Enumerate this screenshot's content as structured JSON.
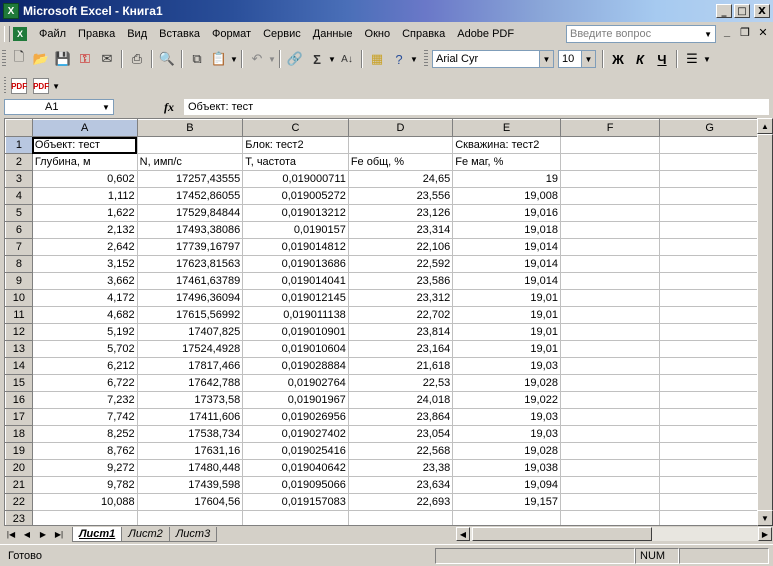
{
  "window": {
    "title": "Microsoft Excel - Книга1",
    "minimize": "_",
    "maximize": "□",
    "close": "X"
  },
  "menu": {
    "items": [
      "Файл",
      "Правка",
      "Вид",
      "Вставка",
      "Формат",
      "Сервис",
      "Данные",
      "Окно",
      "Справка",
      "Adobe PDF"
    ],
    "help_placeholder": "Введите вопрос"
  },
  "format_toolbar": {
    "font_name": "Arial Cyr",
    "font_size": "10",
    "bold": "Ж",
    "italic": "К",
    "underline": "Ч"
  },
  "formula_bar": {
    "cell_ref": "A1",
    "fx": "fx",
    "content": "Объект: тест"
  },
  "sheet": {
    "columns": [
      "A",
      "B",
      "C",
      "D",
      "E",
      "F",
      "G"
    ],
    "rows": [
      [
        "Объект: тест",
        "",
        "Блок: тест2",
        "",
        "Скважина: тест2",
        "",
        ""
      ],
      [
        "Глубина, м",
        "N, имп/с",
        "T, частота",
        "Fe общ, %",
        "Fe маг, %",
        "",
        ""
      ],
      [
        "0,602",
        "17257,43555",
        "0,019000711",
        "24,65",
        "19",
        "",
        ""
      ],
      [
        "1,112",
        "17452,86055",
        "0,019005272",
        "23,556",
        "19,008",
        "",
        ""
      ],
      [
        "1,622",
        "17529,84844",
        "0,019013212",
        "23,126",
        "19,016",
        "",
        ""
      ],
      [
        "2,132",
        "17493,38086",
        "0,0190157",
        "23,314",
        "19,018",
        "",
        ""
      ],
      [
        "2,642",
        "17739,16797",
        "0,019014812",
        "22,106",
        "19,014",
        "",
        ""
      ],
      [
        "3,152",
        "17623,81563",
        "0,019013686",
        "22,592",
        "19,014",
        "",
        ""
      ],
      [
        "3,662",
        "17461,63789",
        "0,019014041",
        "23,586",
        "19,014",
        "",
        ""
      ],
      [
        "4,172",
        "17496,36094",
        "0,019012145",
        "23,312",
        "19,01",
        "",
        ""
      ],
      [
        "4,682",
        "17615,56992",
        "0,019011138",
        "22,702",
        "19,01",
        "",
        ""
      ],
      [
        "5,192",
        "17407,825",
        "0,019010901",
        "23,814",
        "19,01",
        "",
        ""
      ],
      [
        "5,702",
        "17524,4928",
        "0,019010604",
        "23,164",
        "19,01",
        "",
        ""
      ],
      [
        "6,212",
        "17817,466",
        "0,019028884",
        "21,618",
        "19,03",
        "",
        ""
      ],
      [
        "6,722",
        "17642,788",
        "0,01902764",
        "22,53",
        "19,028",
        "",
        ""
      ],
      [
        "7,232",
        "17373,58",
        "0,01901967",
        "24,018",
        "19,022",
        "",
        ""
      ],
      [
        "7,742",
        "17411,606",
        "0,019026956",
        "23,864",
        "19,03",
        "",
        ""
      ],
      [
        "8,252",
        "17538,734",
        "0,019027402",
        "23,054",
        "19,03",
        "",
        ""
      ],
      [
        "8,762",
        "17631,16",
        "0,019025416",
        "22,568",
        "19,028",
        "",
        ""
      ],
      [
        "9,272",
        "17480,448",
        "0,019040642",
        "23,38",
        "19,038",
        "",
        ""
      ],
      [
        "9,782",
        "17439,598",
        "0,019095066",
        "23,634",
        "19,094",
        "",
        ""
      ],
      [
        "10,088",
        "17604,56",
        "0,019157083",
        "22,693",
        "19,157",
        "",
        ""
      ],
      [
        "",
        "",
        "",
        "",
        "",
        "",
        ""
      ]
    ]
  },
  "tabs": [
    "Лист1",
    "Лист2",
    "Лист3"
  ],
  "status": {
    "text": "Готово",
    "num": "NUM"
  }
}
